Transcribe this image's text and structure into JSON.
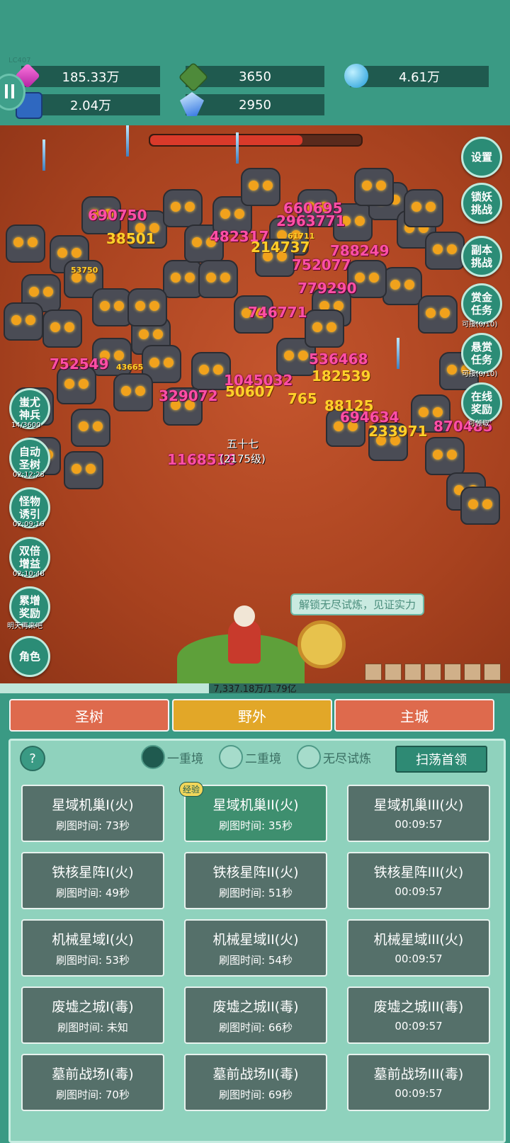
{
  "version": "LC407",
  "resources": [
    {
      "icon": "gem-icon",
      "value": "185.33万"
    },
    {
      "icon": "green-crystal-icon",
      "value": "3650"
    },
    {
      "icon": "blue-orb-icon",
      "value": "4.61万"
    },
    {
      "icon": "book-icon",
      "value": "2.04万"
    },
    {
      "icon": "blue-shard-icon",
      "value": "2950"
    }
  ],
  "right_buttons": [
    {
      "label": "设置",
      "sub": ""
    },
    {
      "label": "锁妖挑战",
      "sub": ""
    },
    {
      "label": "副本挑战",
      "sub": ""
    },
    {
      "label": "赏金任务",
      "sub": "可接(0/10)"
    },
    {
      "label": "悬赏任务",
      "sub": "可接(0/10)"
    },
    {
      "label": "在线奖励",
      "sub": "可领取"
    }
  ],
  "left_buttons": [
    {
      "label": "蚩尤神兵",
      "sub": "14/3600"
    },
    {
      "label": "自动圣树",
      "sub": "02:12:23"
    },
    {
      "label": "怪物诱引",
      "sub": "02:09:19"
    },
    {
      "label": "双倍增益",
      "sub": "02:10:48"
    },
    {
      "label": "累增奖励",
      "sub": "明天再来吧"
    },
    {
      "label": "角色",
      "sub": ""
    }
  ],
  "damage_numbers": [
    "690750",
    "38501",
    "660695",
    "482317",
    "788249",
    "214737",
    "752077",
    "779290",
    "746771",
    "536468",
    "182539",
    "752549",
    "1045032",
    "50607",
    "765",
    "88125",
    "694634",
    "233971",
    "870485",
    "329072",
    "1168516",
    "2963771",
    "53750",
    "43665",
    "61711"
  ],
  "hero": {
    "name": "五十七",
    "level": "(2175级)"
  },
  "hint": "解锁无尽试炼，见证实力",
  "xp_text": "7,337.18万/1.79亿",
  "xp_fraction": 0.41,
  "boss_hp_fraction": 0.72,
  "tabs": [
    {
      "label": "圣树",
      "color": "#de6a4d"
    },
    {
      "label": "野外",
      "color": "#e2a728"
    },
    {
      "label": "主城",
      "color": "#de6a4d"
    }
  ],
  "help_label": "?",
  "realms": [
    {
      "label": "一重境",
      "selected": true
    },
    {
      "label": "二重境",
      "selected": false
    },
    {
      "label": "无尽试炼",
      "selected": false
    }
  ],
  "sweep_label": "扫荡首领",
  "exp_badge": "经验",
  "stages": [
    [
      {
        "title": "星域机巢I(火)",
        "sub": "刷图时间: 73秒"
      },
      {
        "title": "星域机巢II(火)",
        "sub": "刷图时间: 35秒"
      },
      {
        "title": "星域机巢III(火)",
        "sub": "00:09:57"
      }
    ],
    [
      {
        "title": "铁核星阵I(火)",
        "sub": "刷图时间: 49秒"
      },
      {
        "title": "铁核星阵II(火)",
        "sub": "刷图时间: 51秒"
      },
      {
        "title": "铁核星阵III(火)",
        "sub": "00:09:57"
      }
    ],
    [
      {
        "title": "机械星域I(火)",
        "sub": "刷图时间: 53秒"
      },
      {
        "title": "机械星域II(火)",
        "sub": "刷图时间: 54秒"
      },
      {
        "title": "机械星域III(火)",
        "sub": "00:09:57"
      }
    ],
    [
      {
        "title": "废墟之城I(毒)",
        "sub": "刷图时间: 未知"
      },
      {
        "title": "废墟之城II(毒)",
        "sub": "刷图时间: 66秒"
      },
      {
        "title": "废墟之城III(毒)",
        "sub": "00:09:57"
      }
    ],
    [
      {
        "title": "墓前战场I(毒)",
        "sub": "刷图时间: 70秒"
      },
      {
        "title": "墓前战场II(毒)",
        "sub": "刷图时间: 69秒"
      },
      {
        "title": "墓前战场III(毒)",
        "sub": "00:09:57"
      }
    ]
  ]
}
